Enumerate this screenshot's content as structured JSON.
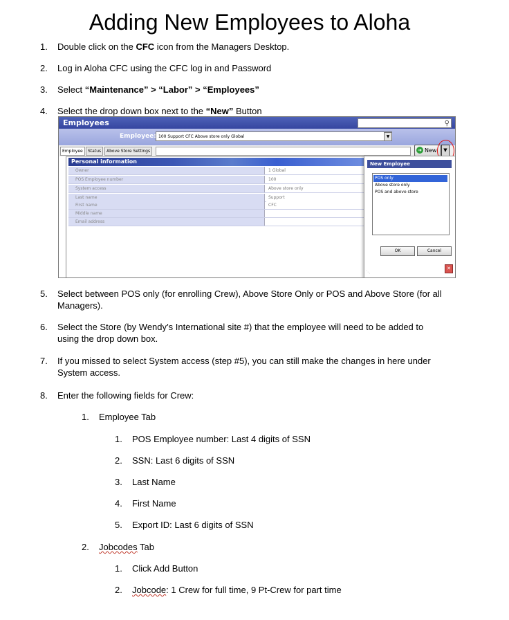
{
  "title": "Adding New Employees to Aloha",
  "steps": {
    "s1": {
      "num": "1.",
      "pre": "Double click on the ",
      "bold": "CFC",
      "post": " icon from the Managers Desktop."
    },
    "s2": {
      "num": "2.",
      "text": "Log in Aloha CFC using the CFC log in and Password"
    },
    "s3": {
      "num": "3.",
      "pre": "Select ",
      "bold": "“Maintenance” > “Labor” > “Employees”"
    },
    "s4": {
      "num": "4.",
      "pre": "Select the drop down box next to the ",
      "bold": "“New”",
      "post": " Button"
    },
    "s5": {
      "num": "5.",
      "line1": "Select between POS only (for enrolling Crew), Above Store Only or POS and Above Store (for all",
      "line2": "Managers)."
    },
    "s6": {
      "num": "6.",
      "line1": "Select the Store (by Wendy’s International site #) that the employee will need to be added to",
      "line2": "using the drop down box."
    },
    "s7": {
      "num": "7.",
      "line1": "If you missed to select System access (step #5), you can still make the changes in here under",
      "line2": "System access."
    },
    "s8": {
      "num": "8.",
      "text": "Enter the following fields for Crew:"
    }
  },
  "sub": {
    "a": {
      "num": "1.",
      "text": "Employee Tab"
    },
    "a1": {
      "num": "1.",
      "text": "POS Employee number: Last 4 digits of SSN"
    },
    "a2": {
      "num": "2.",
      "text": "SSN: Last 6 digits of SSN"
    },
    "a3": {
      "num": "3.",
      "text": "Last Name"
    },
    "a4": {
      "num": "4.",
      "text": "First Name"
    },
    "a5": {
      "num": "5.",
      "text": "Export ID: Last 6 digits of SSN"
    },
    "b": {
      "num": "2.",
      "word": "Jobcodes",
      "rest": " Tab"
    },
    "b1": {
      "num": "1.",
      "text": "Click Add Button"
    },
    "b2": {
      "num": "2.",
      "word": "Jobcode",
      "rest": ": 1 Crew for full time, 9 Pt-Crew for part time"
    }
  },
  "screenshot": {
    "window_title": "Employees",
    "employee_label": "Employee:",
    "employee_value": "100 Support CFC Above store only Global",
    "tabs": [
      "Employee",
      "Status",
      "Above Store Settings"
    ],
    "new_button": "New",
    "section_title": "Personal information",
    "fields": [
      {
        "label": "Owner",
        "value": "1 Global"
      },
      {
        "label": "POS Employee number",
        "value": "100"
      },
      {
        "label": "System access",
        "value": "Above store only"
      },
      {
        "label": "Last name",
        "value": "Support"
      },
      {
        "label": "First name",
        "value": "CFC"
      },
      {
        "label": "Middle name",
        "value": ""
      },
      {
        "label": "Email address",
        "value": ""
      }
    ],
    "dialog": {
      "title": "New Employee",
      "options": [
        "POS only",
        "Above store only",
        "POS and above store"
      ],
      "selected": "POS only",
      "ok": "OK",
      "cancel": "Cancel"
    }
  }
}
